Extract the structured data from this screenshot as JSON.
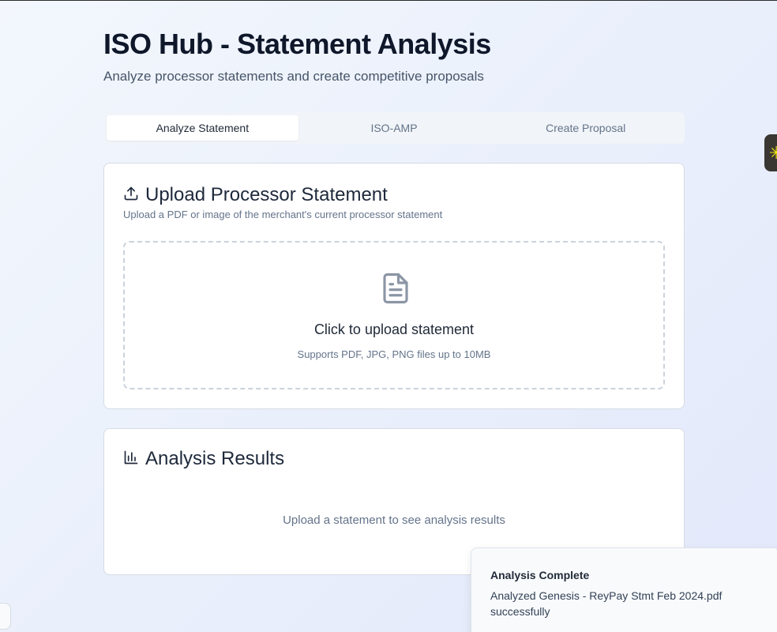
{
  "header": {
    "title": "ISO Hub - Statement Analysis",
    "subtitle": "Analyze processor statements and create competitive proposals"
  },
  "tabs": [
    {
      "label": "Analyze Statement",
      "active": true
    },
    {
      "label": "ISO-AMP",
      "active": false
    },
    {
      "label": "Create Proposal",
      "active": false
    }
  ],
  "upload_card": {
    "icon": "upload-icon",
    "title": "Upload Processor Statement",
    "description": "Upload a PDF or image of the merchant's current processor statement",
    "dropzone": {
      "icon": "file-text-icon",
      "title": "Click to upload statement",
      "hint": "Supports PDF, JPG, PNG files up to 10MB"
    }
  },
  "results_card": {
    "icon": "bar-chart-icon",
    "title": "Analysis Results",
    "empty_message": "Upload a statement to see analysis results"
  },
  "toast": {
    "title": "Analysis Complete",
    "message": "Analyzed Genesis - ReyPay Stmt Feb 2024.pdf successfully"
  },
  "side_widget": {
    "glyph": "✳",
    "color": "#f4e90f"
  },
  "colors": {
    "heading": "#0f172a",
    "muted": "#64748b",
    "card_border": "#d6dbe3",
    "dropzone_border": "#cbd2dc"
  }
}
